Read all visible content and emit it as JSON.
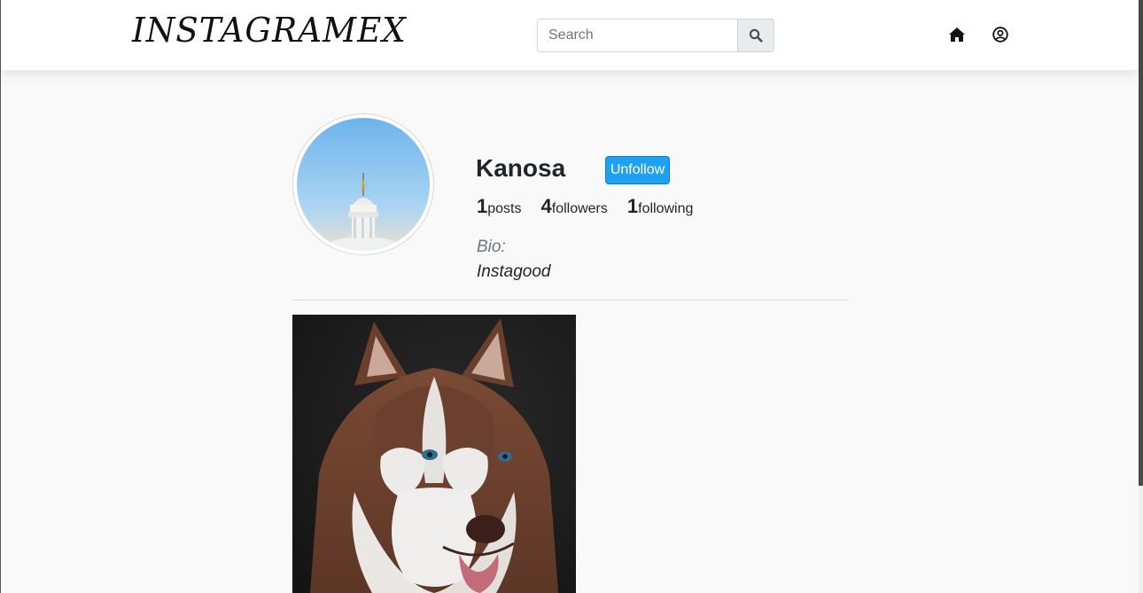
{
  "navbar": {
    "brand": "INSTAGRAMEX",
    "search": {
      "placeholder": "Search",
      "value": ""
    },
    "icons": [
      "search-icon",
      "home-icon",
      "user-circle-icon"
    ]
  },
  "profile": {
    "username": "Kanosa",
    "follow_button": "Unfollow",
    "stats": [
      {
        "count": "1",
        "label": "posts"
      },
      {
        "count": "4",
        "label": "followers"
      },
      {
        "count": "1",
        "label": "following"
      }
    ],
    "bio_label": "Bio:",
    "bio": "Instagood"
  },
  "colors": {
    "accent": "#1ea1f2",
    "background": "#f9f9f9",
    "navbar": "#ffffff"
  }
}
